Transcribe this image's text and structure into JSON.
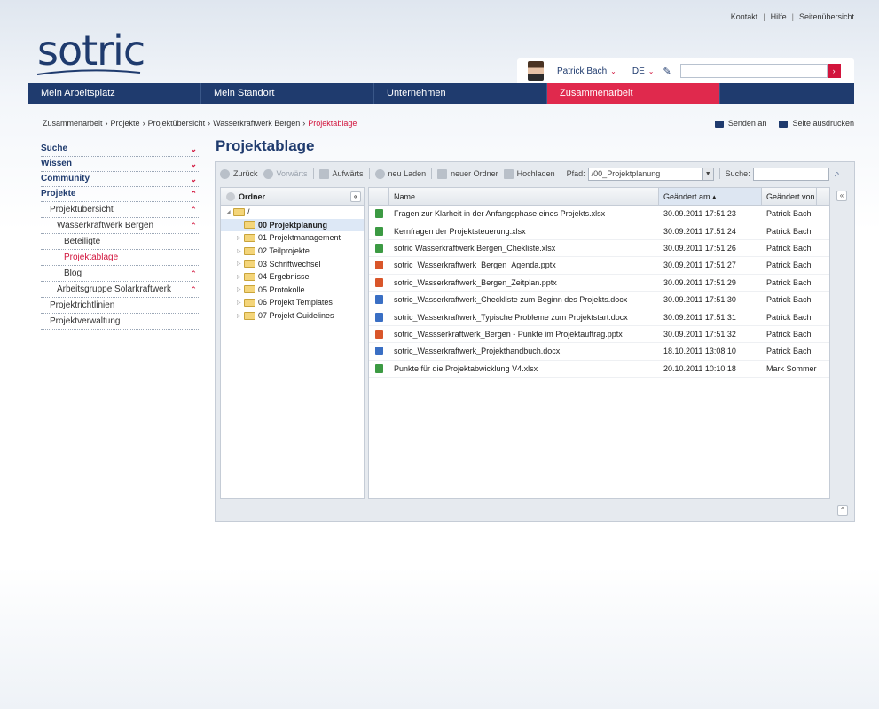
{
  "toplinks": {
    "kontakt": "Kontakt",
    "hilfe": "Hilfe",
    "sitemap": "Seitenübersicht"
  },
  "logo": {
    "text": "sotric"
  },
  "user": {
    "name": "Patrick Bach",
    "lang": "DE",
    "search_value": ""
  },
  "mainnav": [
    {
      "label": "Mein Arbeitsplatz"
    },
    {
      "label": "Mein Standort"
    },
    {
      "label": "Unternehmen"
    },
    {
      "label": "Zusammenarbeit",
      "active": true
    }
  ],
  "breadcrumb": [
    "Zusammenarbeit",
    "Projekte",
    "Projektübersicht",
    "Wasserkraftwerk Bergen",
    "Projektablage"
  ],
  "actions": {
    "send": "Senden an",
    "print": "Seite ausdrucken"
  },
  "leftnav": [
    {
      "label": "Suche",
      "bold": true,
      "arrow": "⌄"
    },
    {
      "label": "Wissen",
      "bold": true,
      "arrow": "⌄"
    },
    {
      "label": "Community",
      "bold": true,
      "arrow": "⌄"
    },
    {
      "label": "Projekte",
      "bold": true,
      "arrow": "⌃"
    },
    {
      "label": "Projektübersicht",
      "level": 1,
      "arrow": "⌃"
    },
    {
      "label": "Wasserkraftwerk Bergen",
      "level": 2,
      "arrow": "⌃"
    },
    {
      "label": "Beteiligte",
      "level": 3
    },
    {
      "label": "Projektablage",
      "level": 3,
      "active": true
    },
    {
      "label": "Blog",
      "level": 3,
      "arrow": "⌃"
    },
    {
      "label": "Arbeitsgruppe Solarkraftwerk",
      "level": 2,
      "arrow": "⌃"
    },
    {
      "label": "Projektrichtlinien",
      "level": 1
    },
    {
      "label": "Projektverwaltung",
      "level": 1
    }
  ],
  "page": {
    "title": "Projektablage"
  },
  "toolbar": {
    "back": "Zurück",
    "forward": "Vorwärts",
    "up": "Aufwärts",
    "reload": "neu Laden",
    "new_folder": "neuer Ordner",
    "upload": "Hochladen",
    "path_label": "Pfad:",
    "path_value": "/00_Projektplanung",
    "search_label": "Suche:",
    "search_value": ""
  },
  "tree": {
    "header": "Ordner",
    "root": "/",
    "folders": [
      {
        "label": "00 Projektplanung",
        "selected": true
      },
      {
        "label": "01 Projektmanagement"
      },
      {
        "label": "02 Teilprojekte"
      },
      {
        "label": "03 Schriftwechsel"
      },
      {
        "label": "04 Ergebnisse"
      },
      {
        "label": "05 Protokolle"
      },
      {
        "label": "06 Projekt Templates"
      },
      {
        "label": "07 Projekt Guidelines"
      }
    ]
  },
  "files": {
    "columns": {
      "name": "Name",
      "changed": "Geändert am ▴",
      "by": "Geändert von"
    },
    "rows": [
      {
        "type": "xlsx",
        "name": "Fragen zur Klarheit in der Anfangsphase eines Projekts.xlsx",
        "changed": "30.09.2011 17:51:23",
        "by": "Patrick Bach"
      },
      {
        "type": "xlsx",
        "name": "Kernfragen der Projektsteuerung.xlsx",
        "changed": "30.09.2011 17:51:24",
        "by": "Patrick Bach"
      },
      {
        "type": "xlsx",
        "name": "sotric Wasserkraftwerk Bergen_Chekliste.xlsx",
        "changed": "30.09.2011 17:51:26",
        "by": "Patrick Bach"
      },
      {
        "type": "pptx",
        "name": "sotric_Wasserkraftwerk_Bergen_Agenda.pptx",
        "changed": "30.09.2011 17:51:27",
        "by": "Patrick Bach"
      },
      {
        "type": "pptx",
        "name": "sotric_Wasserkraftwerk_Bergen_Zeitplan.pptx",
        "changed": "30.09.2011 17:51:29",
        "by": "Patrick Bach"
      },
      {
        "type": "docx",
        "name": "sotric_Wasserkraftwerk_Checkliste zum Beginn des Projekts.docx",
        "changed": "30.09.2011 17:51:30",
        "by": "Patrick Bach"
      },
      {
        "type": "docx",
        "name": "sotric_Wasserkraftwerk_Typische Probleme zum Projektstart.docx",
        "changed": "30.09.2011 17:51:31",
        "by": "Patrick Bach"
      },
      {
        "type": "pptx",
        "name": "sotric_Wassserkraftwerk_Bergen - Punkte im Projektauftrag.pptx",
        "changed": "30.09.2011 17:51:32",
        "by": "Patrick Bach"
      },
      {
        "type": "docx",
        "name": "sotric_Wasserkraftwerk_Projekthandbuch.docx",
        "changed": "18.10.2011 13:08:10",
        "by": "Patrick Bach"
      },
      {
        "type": "xlsx",
        "name": "Punkte für die Projektabwicklung V4.xlsx",
        "changed": "20.10.2011 10:10:18",
        "by": "Mark Sommer"
      }
    ]
  },
  "colors": {
    "navy": "#1f3b6e",
    "accent": "#e0294d"
  }
}
